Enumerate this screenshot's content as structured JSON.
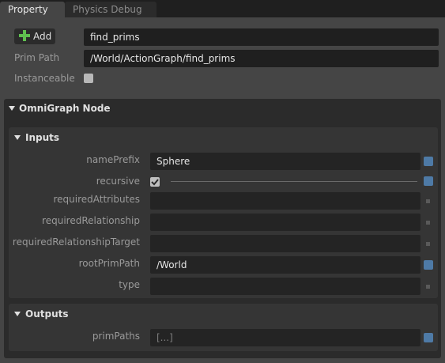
{
  "tabs": [
    {
      "label": "Property"
    },
    {
      "label": "Physics Debug"
    }
  ],
  "header": {
    "add_label": "Add",
    "name_value": "find_prims",
    "prim_path_label": "Prim Path",
    "prim_path_value": "/World/ActionGraph/find_prims",
    "instanceable_label": "Instanceable"
  },
  "section": {
    "title": "OmniGraph Node",
    "inputs": {
      "title": "Inputs",
      "rows": [
        {
          "label": "namePrefix",
          "value": "Sphere"
        },
        {
          "label": "recursive"
        },
        {
          "label": "requiredAttributes",
          "value": ""
        },
        {
          "label": "requiredRelationship",
          "value": ""
        },
        {
          "label": "requiredRelationshipTarget",
          "value": ""
        },
        {
          "label": "rootPrimPath",
          "value": "/World"
        },
        {
          "label": "type",
          "value": ""
        }
      ]
    },
    "outputs": {
      "title": "Outputs",
      "rows": [
        {
          "label": "primPaths",
          "value": "[...]"
        }
      ]
    }
  },
  "colors": {
    "accent_blue": "#4e7aa6",
    "add_plus_green": "#5fbf4f"
  }
}
